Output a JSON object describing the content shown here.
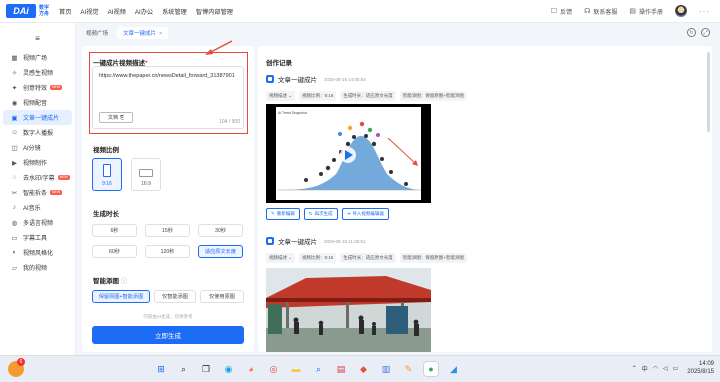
{
  "topnav": {
    "logo_mark": "DAi",
    "logo_text_1": "数字",
    "logo_text_2": "方舟",
    "items": [
      "首页",
      "AI视觉",
      "AI视频",
      "AI办公",
      "系统管理",
      "智博内部管理"
    ],
    "right": {
      "feedback": "反馈",
      "contact": "联系客服",
      "manual": "操作手册"
    }
  },
  "sidebar": {
    "items": [
      {
        "label": "视频广场",
        "icon": "grid-icon"
      },
      {
        "label": "灵感生视频",
        "icon": "bulb-icon"
      },
      {
        "label": "创意特效",
        "icon": "sparkle-icon",
        "badge": "NEW"
      },
      {
        "label": "视频配音",
        "icon": "mic-icon"
      },
      {
        "label": "文章一键成片",
        "icon": "article-icon",
        "active": true
      },
      {
        "label": "数字人播报",
        "icon": "person-icon"
      },
      {
        "label": "AI分镜",
        "icon": "storyboard-icon"
      },
      {
        "label": "视频制作",
        "icon": "film-icon"
      },
      {
        "label": "去水印/字幕",
        "icon": "eraser-icon",
        "badge": "NEW"
      },
      {
        "label": "智能拆条",
        "icon": "scissors-icon",
        "badge": "NEW"
      },
      {
        "label": "AI音乐",
        "icon": "music-icon"
      },
      {
        "label": "多语言视频",
        "icon": "globe-icon"
      },
      {
        "label": "字幕工具",
        "icon": "subtitle-icon"
      },
      {
        "label": "视频风格化",
        "icon": "palette-icon"
      },
      {
        "label": "我的视频",
        "icon": "folder-icon"
      }
    ]
  },
  "tabs": [
    {
      "label": "视频广场",
      "active": false
    },
    {
      "label": "文章一键成片",
      "active": true
    }
  ],
  "form": {
    "desc_title": "一键成片视频描述",
    "desc_value": "https://www.thepaper.cn/newsDetail_forward_31387901",
    "doc_button": "文档",
    "counter": "104 / 500",
    "ratio_title": "视频比例",
    "ratios": [
      {
        "label": "9:16",
        "selected": true
      },
      {
        "label": "16:9",
        "selected": false
      }
    ],
    "duration_title": "生成时长",
    "durations": [
      {
        "label": "6秒",
        "selected": false
      },
      {
        "label": "15秒",
        "selected": false
      },
      {
        "label": "30秒",
        "selected": false
      },
      {
        "label": "60秒",
        "selected": false
      },
      {
        "label": "120秒",
        "selected": false
      },
      {
        "label": "适应原文长度",
        "selected": true
      }
    ],
    "image_title": "智能添图",
    "image_opts": [
      {
        "label": "保留原图+智能添图",
        "selected": true
      },
      {
        "label": "仅智能添图",
        "selected": false
      },
      {
        "label": "仅使用原图",
        "selected": false
      }
    ],
    "hint": "内容由AI生成，仅供参考",
    "submit": "立即生成"
  },
  "history": {
    "title": "创作记录",
    "records": [
      {
        "name": "文章一键成片",
        "time": "2025-08-15 14:05:54",
        "tags": [
          "视频描述",
          "视频比例：9:16",
          "生成时长：适应原文长度",
          "智能添图：保留原图+智能添图"
        ],
        "actions": [
          "重新编辑",
          "再次生成",
          "导入视频编辑器"
        ]
      },
      {
        "name": "文章一键成片",
        "time": "2025-08-15 11:35:51",
        "tags": [
          "视频描述",
          "视频比例：9:16",
          "生成时长：适应原文长度",
          "智能添图：保留原图+智能添图"
        ]
      }
    ]
  },
  "taskbar": {
    "badge": "6",
    "time": "14:09",
    "date": "2025/8/15",
    "lang": "中"
  },
  "colors": {
    "accent": "#1d6cf5",
    "highlight": "#e24a3b"
  }
}
